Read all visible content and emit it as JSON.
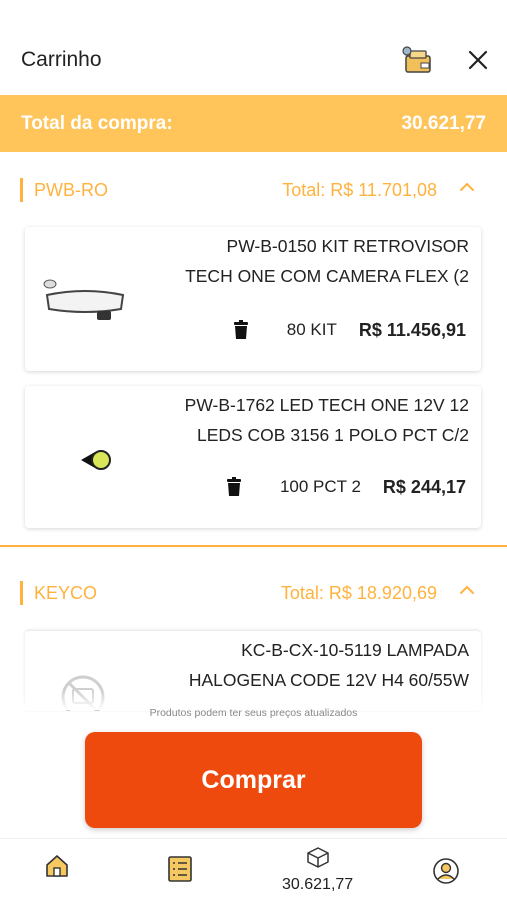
{
  "header": {
    "title": "Carrinho",
    "cart_icon": "cart-box-icon",
    "close_icon": "close-icon"
  },
  "total_bar": {
    "label": "Total da compra:",
    "value": "30.621,77"
  },
  "sections": [
    {
      "name": "PWB-RO",
      "total": "Total: R$ 11.701,08",
      "items": [
        {
          "desc_line1": "PW-B-0150 KIT RETROVISOR",
          "desc_line2": "TECH ONE COM CAMERA FLEX (2",
          "qty": "80 KIT",
          "price": "R$ 11.456,91"
        },
        {
          "desc_line1": "PW-B-1762 LED TECH ONE 12V 12",
          "desc_line2": "LEDS COB 3156 1 POLO PCT C/2",
          "qty": "100 PCT 2",
          "price": "R$ 244,17"
        }
      ]
    },
    {
      "name": "KEYCO",
      "total": "Total: R$ 18.920,69",
      "items": [
        {
          "desc_line1": "KC-B-CX-10-5119 LAMPADA",
          "desc_line2": "HALOGENA CODE 12V H4 60/55W"
        }
      ]
    }
  ],
  "note": "Produtos podem ter seus preços atualizados",
  "buy_button": "Comprar",
  "tabbar": {
    "home_icon": "home-icon",
    "list_icon": "list-icon",
    "cart_total": "30.621,77",
    "profile_icon": "user-icon"
  },
  "colors": {
    "accent": "#ffb23e",
    "total_bar": "#ffc55a",
    "buy_button": "#ef4a0e"
  }
}
